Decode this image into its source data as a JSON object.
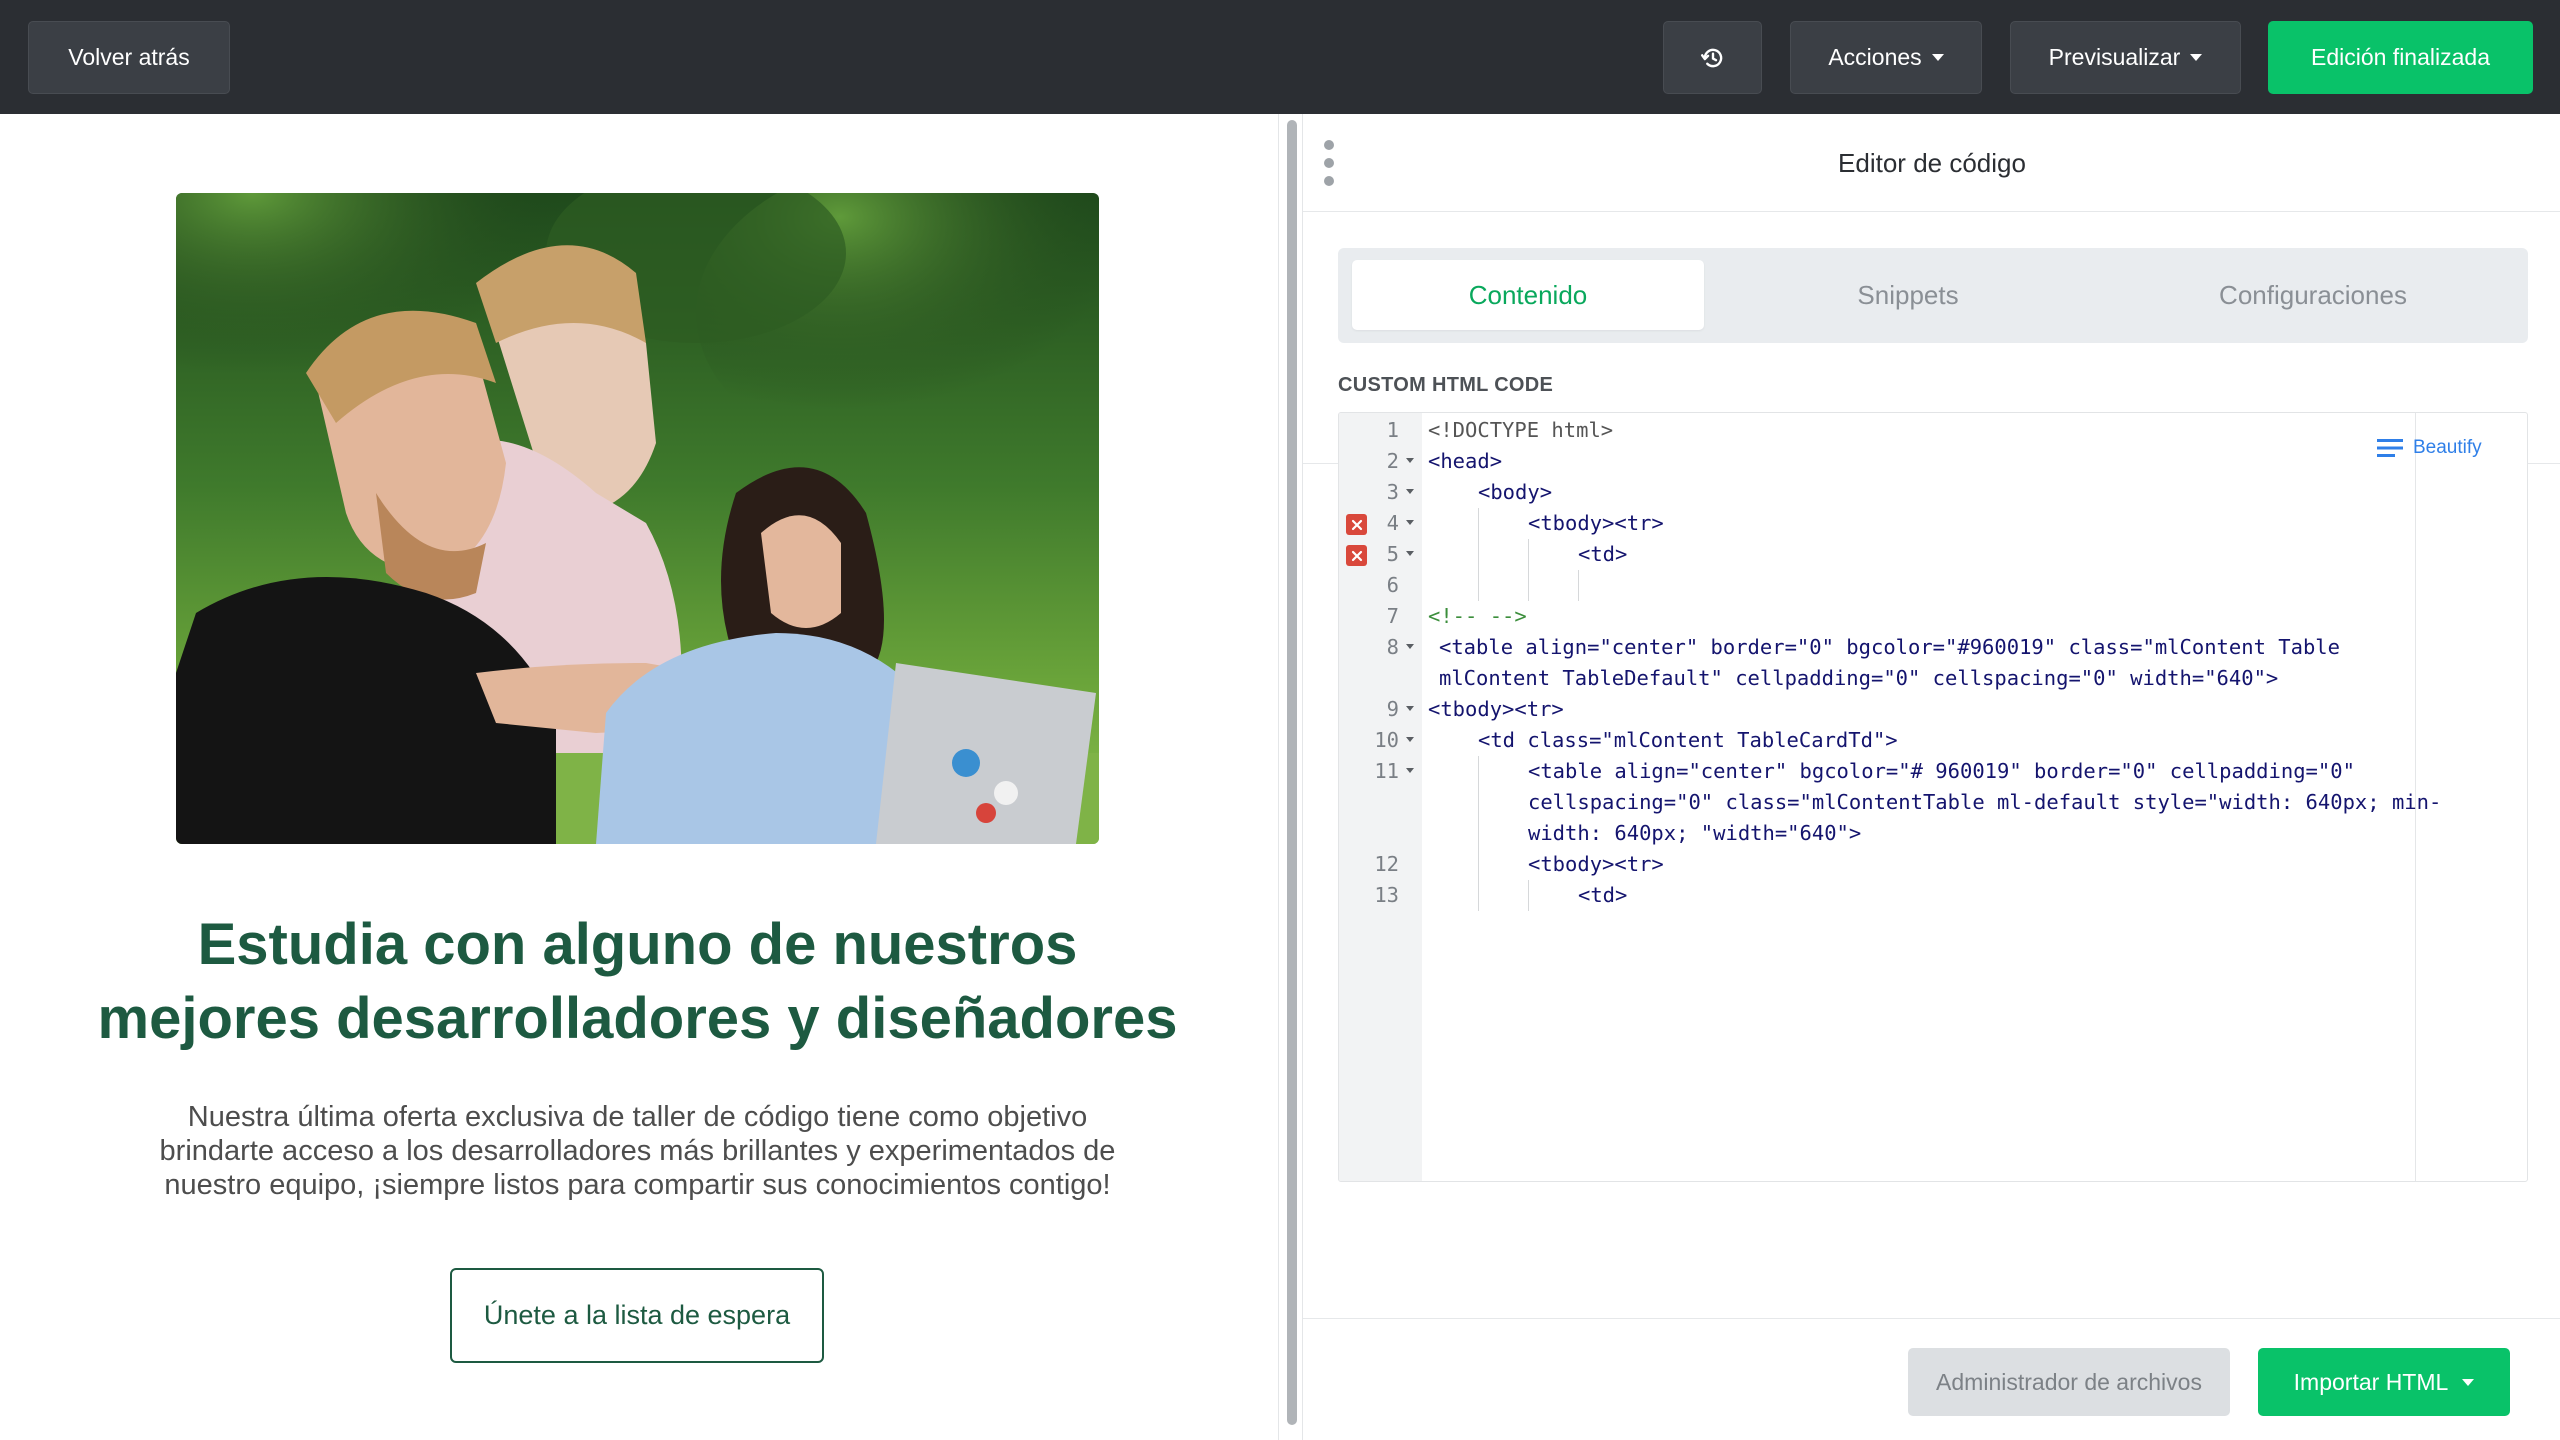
{
  "toolbar": {
    "back_label": "Volver atrás",
    "history_icon": "history-icon",
    "actions_label": "Acciones",
    "preview_label": "Previsualizar",
    "done_label": "Edición finalizada",
    "accent_color": "#09c269"
  },
  "preview": {
    "image_alt": "Tres personas mirando un portátil en un parque",
    "title_line1": "Estudia con alguno de nuestros",
    "title_line2": "mejores desarrolladores y diseñadores",
    "body_line1": "Nuestra última oferta exclusiva de taller de código tiene como objetivo",
    "body_line2": "brindarte acceso a los desarrolladores más brillantes y experimentados de",
    "body_line3": "nuestro equipo, ¡siempre listos para compartir sus conocimientos contigo!",
    "cta_label": "Únete a la lista de espera",
    "title_color": "#1d5a41"
  },
  "panel": {
    "title": "Editor de código",
    "tabs": [
      {
        "label": "Contenido",
        "active": true
      },
      {
        "label": "Snippets",
        "active": false
      },
      {
        "label": "Configuraciones",
        "active": false
      }
    ],
    "code_section_label": "CUSTOM HTML CODE",
    "beautify_label": "Beautify",
    "files_button": "Administrador de archivos",
    "import_button": "Importar HTML"
  },
  "code_lines": [
    {
      "n": "1",
      "text": "<!DOCTYPE html>"
    },
    {
      "n": "2",
      "text": "<head>"
    },
    {
      "n": "3",
      "text": "<body>"
    },
    {
      "n": "4",
      "text": "<tbody><tr>",
      "error": true
    },
    {
      "n": "5",
      "text": "<td>",
      "error": true
    },
    {
      "n": "6",
      "text": ""
    },
    {
      "n": "7",
      "text": "<!-- -->"
    },
    {
      "n": "8",
      "text": "<table align=\"center\" border=\"0\" bgcolor=\"#960019\" class=\"mlContent Table mlContent TableDefault\" cellpadding=\"0\" cellspacing=\"0\" width=\"640\">"
    },
    {
      "n": "9",
      "text": "<tbody><tr>"
    },
    {
      "n": "10",
      "text": "<td class=\"mlContent TableCardTd\">"
    },
    {
      "n": "11",
      "text": "<table align=\"center\" bgcolor=\"# 960019\" border=\"0\" cellpadding=\"0\" cellspacing=\"0\" class=\"mlContentTable ml-default style=\"width: 640px; min-width: 640px; \"width=\"640\">"
    },
    {
      "n": "12",
      "text": "<tbody><tr>"
    },
    {
      "n": "13",
      "text": "<td>"
    }
  ]
}
